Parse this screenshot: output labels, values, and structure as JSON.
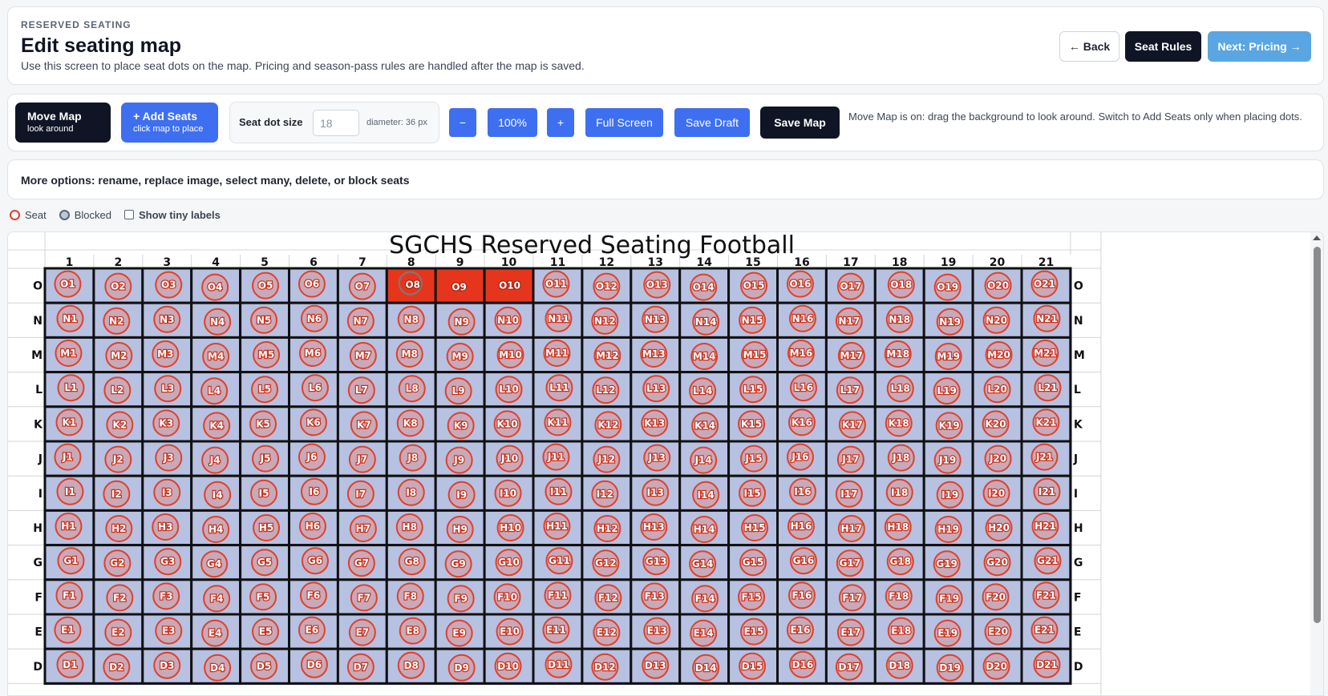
{
  "header": {
    "eyebrow": "RESERVED SEATING",
    "title": "Edit seating map",
    "subtitle": "Use this screen to place seat dots on the map. Pricing and season-pass rules are handled after the map is saved.",
    "back_label": "← Back",
    "rules_label": "Seat Rules",
    "next_label": "Next: Pricing →"
  },
  "toolbar": {
    "move_title": "Move Map",
    "move_sub": "look around",
    "add_title": "+ Add Seats",
    "add_sub": "click map to place",
    "dot_size_label": "Seat dot size",
    "dot_size_value": "18",
    "diameter_text": "diameter: 36 px",
    "minus_label": "−",
    "zoom_label": "100%",
    "plus_label": "+",
    "fullscreen_label": "Full Screen",
    "save_draft_label": "Save Draft",
    "save_map_label": "Save Map",
    "hint": "Move Map is on: drag the background to look around. Switch to Add Seats only when placing dots."
  },
  "options": {
    "text": "More options: rename, replace image, select many, delete, or block seats"
  },
  "legend": {
    "seat": "Seat",
    "blocked": "Blocked",
    "tiny_labels": "Show tiny labels"
  },
  "map": {
    "title": "SGCHS Reserved Seating Football",
    "columns": [
      "1",
      "2",
      "3",
      "4",
      "5",
      "6",
      "7",
      "8",
      "9",
      "10",
      "11",
      "12",
      "13",
      "14",
      "15",
      "16",
      "17",
      "18",
      "19",
      "20",
      "21"
    ],
    "rows": [
      "O",
      "N",
      "M",
      "L",
      "K",
      "J",
      "I",
      "H",
      "G",
      "F",
      "E",
      "D"
    ],
    "selected_seats": [
      "O8",
      "O9",
      "O10"
    ],
    "colors": {
      "cell": "#b7c1e1",
      "grid": "#111111",
      "seat_ring": "#e0402a",
      "seat_fill": "#c9a9b8",
      "selected_cell": "#e5361d",
      "selected_ring": "#7b7b7b"
    }
  }
}
